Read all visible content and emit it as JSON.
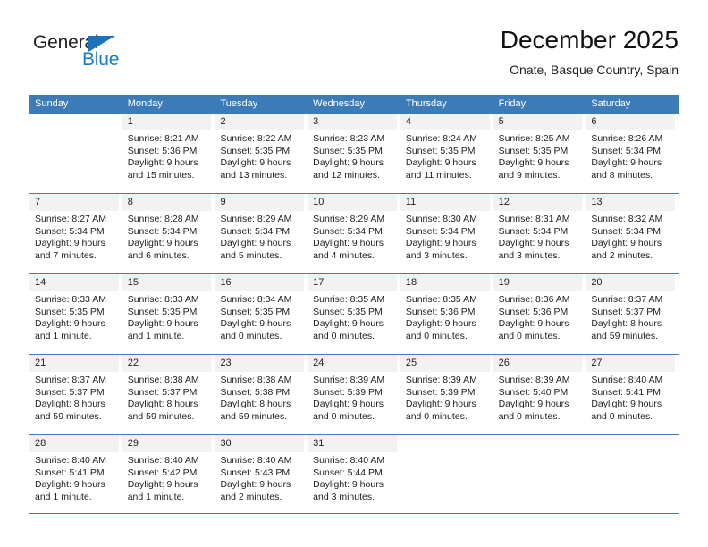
{
  "brand": {
    "name_part1": "General",
    "name_part2": "Blue",
    "triangle_color": "#1e72b8",
    "blue_color": "#1a7cc4"
  },
  "header": {
    "month_title": "December 2025",
    "location": "Onate, Basque Country, Spain"
  },
  "calendar": {
    "header_color": "#3b7cb8",
    "weekdays": [
      "Sunday",
      "Monday",
      "Tuesday",
      "Wednesday",
      "Thursday",
      "Friday",
      "Saturday"
    ],
    "weeks": [
      [
        {
          "day": "",
          "sunrise": "",
          "sunset": "",
          "daylight_line1": "",
          "daylight_line2": "",
          "empty": true
        },
        {
          "day": "1",
          "sunrise": "Sunrise: 8:21 AM",
          "sunset": "Sunset: 5:36 PM",
          "daylight_line1": "Daylight: 9 hours",
          "daylight_line2": "and 15 minutes."
        },
        {
          "day": "2",
          "sunrise": "Sunrise: 8:22 AM",
          "sunset": "Sunset: 5:35 PM",
          "daylight_line1": "Daylight: 9 hours",
          "daylight_line2": "and 13 minutes."
        },
        {
          "day": "3",
          "sunrise": "Sunrise: 8:23 AM",
          "sunset": "Sunset: 5:35 PM",
          "daylight_line1": "Daylight: 9 hours",
          "daylight_line2": "and 12 minutes."
        },
        {
          "day": "4",
          "sunrise": "Sunrise: 8:24 AM",
          "sunset": "Sunset: 5:35 PM",
          "daylight_line1": "Daylight: 9 hours",
          "daylight_line2": "and 11 minutes."
        },
        {
          "day": "5",
          "sunrise": "Sunrise: 8:25 AM",
          "sunset": "Sunset: 5:35 PM",
          "daylight_line1": "Daylight: 9 hours",
          "daylight_line2": "and 9 minutes."
        },
        {
          "day": "6",
          "sunrise": "Sunrise: 8:26 AM",
          "sunset": "Sunset: 5:34 PM",
          "daylight_line1": "Daylight: 9 hours",
          "daylight_line2": "and 8 minutes."
        }
      ],
      [
        {
          "day": "7",
          "sunrise": "Sunrise: 8:27 AM",
          "sunset": "Sunset: 5:34 PM",
          "daylight_line1": "Daylight: 9 hours",
          "daylight_line2": "and 7 minutes."
        },
        {
          "day": "8",
          "sunrise": "Sunrise: 8:28 AM",
          "sunset": "Sunset: 5:34 PM",
          "daylight_line1": "Daylight: 9 hours",
          "daylight_line2": "and 6 minutes."
        },
        {
          "day": "9",
          "sunrise": "Sunrise: 8:29 AM",
          "sunset": "Sunset: 5:34 PM",
          "daylight_line1": "Daylight: 9 hours",
          "daylight_line2": "and 5 minutes."
        },
        {
          "day": "10",
          "sunrise": "Sunrise: 8:29 AM",
          "sunset": "Sunset: 5:34 PM",
          "daylight_line1": "Daylight: 9 hours",
          "daylight_line2": "and 4 minutes."
        },
        {
          "day": "11",
          "sunrise": "Sunrise: 8:30 AM",
          "sunset": "Sunset: 5:34 PM",
          "daylight_line1": "Daylight: 9 hours",
          "daylight_line2": "and 3 minutes."
        },
        {
          "day": "12",
          "sunrise": "Sunrise: 8:31 AM",
          "sunset": "Sunset: 5:34 PM",
          "daylight_line1": "Daylight: 9 hours",
          "daylight_line2": "and 3 minutes."
        },
        {
          "day": "13",
          "sunrise": "Sunrise: 8:32 AM",
          "sunset": "Sunset: 5:34 PM",
          "daylight_line1": "Daylight: 9 hours",
          "daylight_line2": "and 2 minutes."
        }
      ],
      [
        {
          "day": "14",
          "sunrise": "Sunrise: 8:33 AM",
          "sunset": "Sunset: 5:35 PM",
          "daylight_line1": "Daylight: 9 hours",
          "daylight_line2": "and 1 minute."
        },
        {
          "day": "15",
          "sunrise": "Sunrise: 8:33 AM",
          "sunset": "Sunset: 5:35 PM",
          "daylight_line1": "Daylight: 9 hours",
          "daylight_line2": "and 1 minute."
        },
        {
          "day": "16",
          "sunrise": "Sunrise: 8:34 AM",
          "sunset": "Sunset: 5:35 PM",
          "daylight_line1": "Daylight: 9 hours",
          "daylight_line2": "and 0 minutes."
        },
        {
          "day": "17",
          "sunrise": "Sunrise: 8:35 AM",
          "sunset": "Sunset: 5:35 PM",
          "daylight_line1": "Daylight: 9 hours",
          "daylight_line2": "and 0 minutes."
        },
        {
          "day": "18",
          "sunrise": "Sunrise: 8:35 AM",
          "sunset": "Sunset: 5:36 PM",
          "daylight_line1": "Daylight: 9 hours",
          "daylight_line2": "and 0 minutes."
        },
        {
          "day": "19",
          "sunrise": "Sunrise: 8:36 AM",
          "sunset": "Sunset: 5:36 PM",
          "daylight_line1": "Daylight: 9 hours",
          "daylight_line2": "and 0 minutes."
        },
        {
          "day": "20",
          "sunrise": "Sunrise: 8:37 AM",
          "sunset": "Sunset: 5:37 PM",
          "daylight_line1": "Daylight: 8 hours",
          "daylight_line2": "and 59 minutes."
        }
      ],
      [
        {
          "day": "21",
          "sunrise": "Sunrise: 8:37 AM",
          "sunset": "Sunset: 5:37 PM",
          "daylight_line1": "Daylight: 8 hours",
          "daylight_line2": "and 59 minutes."
        },
        {
          "day": "22",
          "sunrise": "Sunrise: 8:38 AM",
          "sunset": "Sunset: 5:37 PM",
          "daylight_line1": "Daylight: 8 hours",
          "daylight_line2": "and 59 minutes."
        },
        {
          "day": "23",
          "sunrise": "Sunrise: 8:38 AM",
          "sunset": "Sunset: 5:38 PM",
          "daylight_line1": "Daylight: 8 hours",
          "daylight_line2": "and 59 minutes."
        },
        {
          "day": "24",
          "sunrise": "Sunrise: 8:39 AM",
          "sunset": "Sunset: 5:39 PM",
          "daylight_line1": "Daylight: 9 hours",
          "daylight_line2": "and 0 minutes."
        },
        {
          "day": "25",
          "sunrise": "Sunrise: 8:39 AM",
          "sunset": "Sunset: 5:39 PM",
          "daylight_line1": "Daylight: 9 hours",
          "daylight_line2": "and 0 minutes."
        },
        {
          "day": "26",
          "sunrise": "Sunrise: 8:39 AM",
          "sunset": "Sunset: 5:40 PM",
          "daylight_line1": "Daylight: 9 hours",
          "daylight_line2": "and 0 minutes."
        },
        {
          "day": "27",
          "sunrise": "Sunrise: 8:40 AM",
          "sunset": "Sunset: 5:41 PM",
          "daylight_line1": "Daylight: 9 hours",
          "daylight_line2": "and 0 minutes."
        }
      ],
      [
        {
          "day": "28",
          "sunrise": "Sunrise: 8:40 AM",
          "sunset": "Sunset: 5:41 PM",
          "daylight_line1": "Daylight: 9 hours",
          "daylight_line2": "and 1 minute."
        },
        {
          "day": "29",
          "sunrise": "Sunrise: 8:40 AM",
          "sunset": "Sunset: 5:42 PM",
          "daylight_line1": "Daylight: 9 hours",
          "daylight_line2": "and 1 minute."
        },
        {
          "day": "30",
          "sunrise": "Sunrise: 8:40 AM",
          "sunset": "Sunset: 5:43 PM",
          "daylight_line1": "Daylight: 9 hours",
          "daylight_line2": "and 2 minutes."
        },
        {
          "day": "31",
          "sunrise": "Sunrise: 8:40 AM",
          "sunset": "Sunset: 5:44 PM",
          "daylight_line1": "Daylight: 9 hours",
          "daylight_line2": "and 3 minutes."
        },
        {
          "day": "",
          "sunrise": "",
          "sunset": "",
          "daylight_line1": "",
          "daylight_line2": "",
          "empty": true
        },
        {
          "day": "",
          "sunrise": "",
          "sunset": "",
          "daylight_line1": "",
          "daylight_line2": "",
          "empty": true
        },
        {
          "day": "",
          "sunrise": "",
          "sunset": "",
          "daylight_line1": "",
          "daylight_line2": "",
          "empty": true
        }
      ]
    ]
  }
}
